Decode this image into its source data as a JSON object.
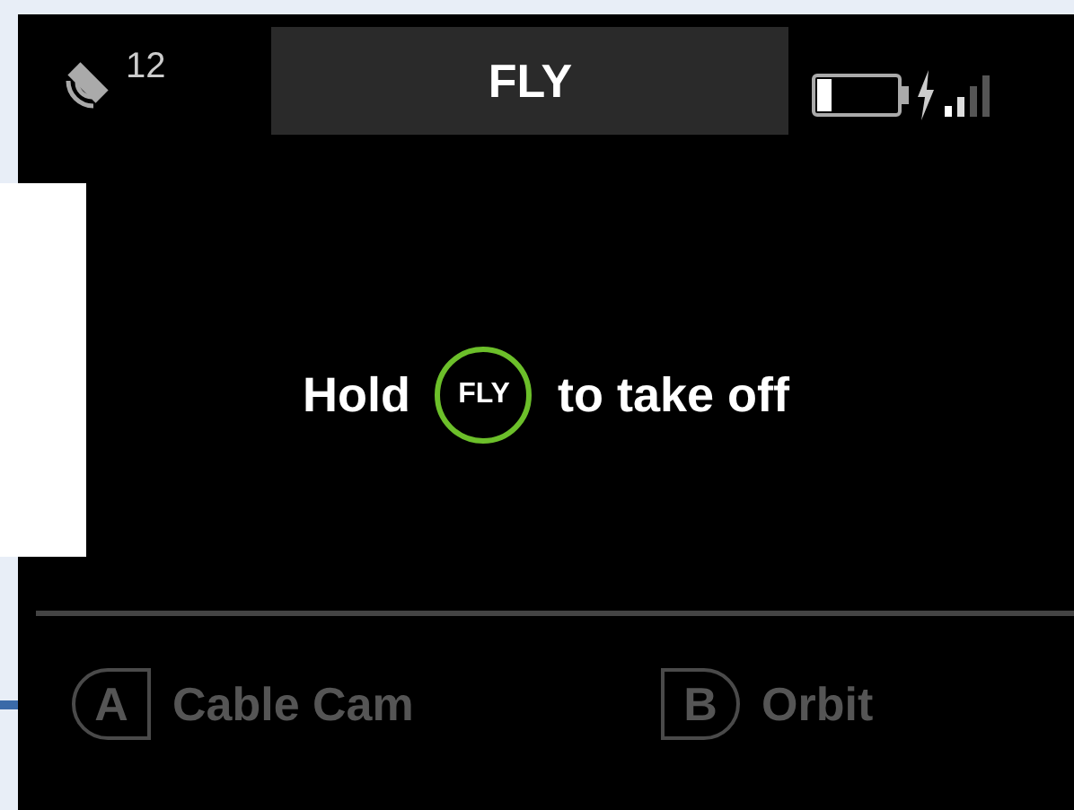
{
  "status_bar": {
    "satellites": "12",
    "title": "FLY"
  },
  "message": {
    "before": "Hold",
    "button": "FLY",
    "after": "to take off"
  },
  "options": [
    {
      "key": "A",
      "label": "Cable Cam",
      "disabled": true
    },
    {
      "key": "B",
      "label": "Orbit",
      "disabled": true
    }
  ]
}
